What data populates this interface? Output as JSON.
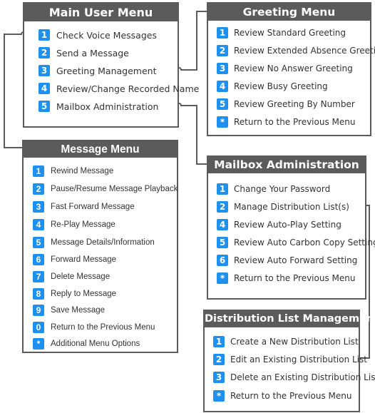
{
  "colors": {
    "header_bg": "#5b5b5b",
    "badge_bg": "#1e90f0",
    "connector": "#5b5b5b",
    "text": "#333333"
  },
  "main_menu": {
    "title": "Main User Menu",
    "items": [
      {
        "key": "1",
        "label": "Check Voice Messages"
      },
      {
        "key": "2",
        "label": "Send a Message"
      },
      {
        "key": "3",
        "label": "Greeting Management"
      },
      {
        "key": "4",
        "label": "Review/Change Recorded Name"
      },
      {
        "key": "5",
        "label": "Mailbox Administration"
      }
    ]
  },
  "greeting_menu": {
    "title": "Greeting Menu",
    "items": [
      {
        "key": "1",
        "label": "Review Standard Greeting"
      },
      {
        "key": "2",
        "label": "Review Extended Absence Greeting"
      },
      {
        "key": "3",
        "label": "Review No Answer Greeting"
      },
      {
        "key": "4",
        "label": "Review Busy Greeting"
      },
      {
        "key": "5",
        "label": "Review Greeting By Number"
      },
      {
        "key": "*",
        "label": "Return to the Previous Menu"
      }
    ]
  },
  "message_menu": {
    "title": "Message Menu",
    "items": [
      {
        "key": "1",
        "label": "Rewind Message"
      },
      {
        "key": "2",
        "label": "Pause/Resume Message Playback"
      },
      {
        "key": "3",
        "label": "Fast Forward Message"
      },
      {
        "key": "4",
        "label": "Re-Play Message"
      },
      {
        "key": "5",
        "label": "Message Details/Information"
      },
      {
        "key": "6",
        "label": "Forward Message"
      },
      {
        "key": "7",
        "label": "Delete Message"
      },
      {
        "key": "8",
        "label": "Reply to Message"
      },
      {
        "key": "9",
        "label": "Save Message"
      },
      {
        "key": "0",
        "label": "Return to the Previous Menu"
      },
      {
        "key": "*",
        "label": "Additional Menu Options"
      }
    ]
  },
  "mailbox_admin": {
    "title": "Mailbox Administration",
    "items": [
      {
        "key": "1",
        "label": "Change Your Password"
      },
      {
        "key": "2",
        "label": "Manage Distribution List(s)"
      },
      {
        "key": "4",
        "label": "Review Auto-Play Setting"
      },
      {
        "key": "5",
        "label": "Review Auto Carbon Copy Setting"
      },
      {
        "key": "6",
        "label": "Review Auto Forward Setting"
      },
      {
        "key": "*",
        "label": "Return to the Previous Menu"
      }
    ]
  },
  "distribution_list": {
    "title": "Distribution List Management",
    "items": [
      {
        "key": "1",
        "label": "Create a New Distribution List"
      },
      {
        "key": "2",
        "label": "Edit an Existing Distribution List"
      },
      {
        "key": "3",
        "label": "Delete an Existing Distribution List"
      },
      {
        "key": "*",
        "label": "Return to the Previous Menu"
      }
    ]
  },
  "connections": [
    {
      "from": "Check Voice Messages",
      "to": "Message Menu"
    },
    {
      "from": "Greeting Management",
      "to": "Greeting Menu"
    },
    {
      "from": "Mailbox Administration",
      "to": "Mailbox Administration"
    },
    {
      "from": "Manage Distribution List(s)",
      "to": "Distribution List Management"
    }
  ]
}
